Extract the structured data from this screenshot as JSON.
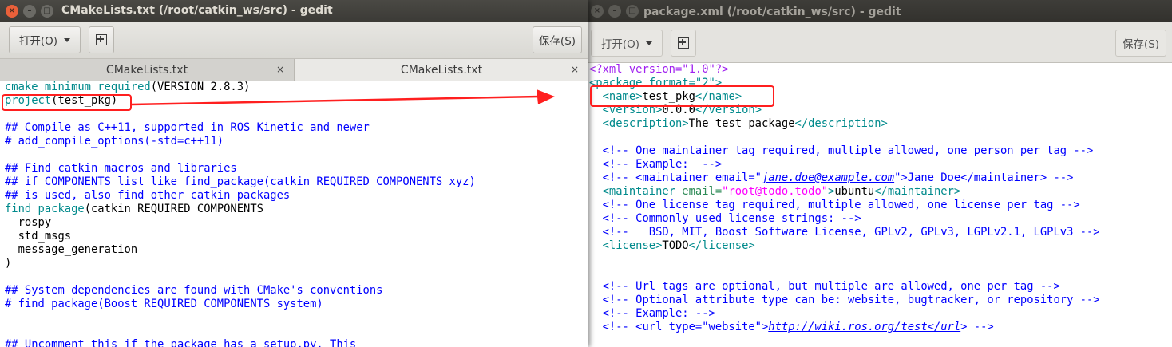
{
  "left_window": {
    "title": "CMakeLists.txt (/root/catkin_ws/src) - gedit",
    "open_label": "打开(O)",
    "save_label": "保存(S)",
    "tabs": [
      {
        "label": "CMakeLists.txt"
      },
      {
        "label": "CMakeLists.txt"
      }
    ],
    "lines": [
      {
        "parts": [
          {
            "t": "cmake_minimum_required",
            "c": "cmd"
          },
          {
            "t": "(VERSION 2.8.3)",
            "c": "txt"
          }
        ]
      },
      {
        "parts": [
          {
            "t": "project",
            "c": "cmd"
          },
          {
            "t": "(test_pkg)",
            "c": "txt"
          }
        ]
      },
      {
        "parts": []
      },
      {
        "parts": [
          {
            "t": "## Compile as C++11, supported in ROS Kinetic and newer",
            "c": "com"
          }
        ]
      },
      {
        "parts": [
          {
            "t": "# add_compile_options(-std=c++11)",
            "c": "com"
          }
        ]
      },
      {
        "parts": []
      },
      {
        "parts": [
          {
            "t": "## Find catkin macros and libraries",
            "c": "com"
          }
        ]
      },
      {
        "parts": [
          {
            "t": "## if COMPONENTS list like find_package(catkin REQUIRED COMPONENTS xyz)",
            "c": "com"
          }
        ]
      },
      {
        "parts": [
          {
            "t": "## is used, also find other catkin packages",
            "c": "com"
          }
        ]
      },
      {
        "parts": [
          {
            "t": "find_package",
            "c": "cmd"
          },
          {
            "t": "(catkin REQUIRED COMPONENTS",
            "c": "txt"
          }
        ]
      },
      {
        "parts": [
          {
            "t": "  rospy",
            "c": "txt"
          }
        ]
      },
      {
        "parts": [
          {
            "t": "  std_msgs",
            "c": "txt"
          }
        ]
      },
      {
        "parts": [
          {
            "t": "  message_generation",
            "c": "txt"
          }
        ]
      },
      {
        "parts": [
          {
            "t": ")",
            "c": "txt"
          }
        ]
      },
      {
        "parts": []
      },
      {
        "parts": [
          {
            "t": "## System dependencies are found with CMake's conventions",
            "c": "com"
          }
        ]
      },
      {
        "parts": [
          {
            "t": "# find_package(Boost REQUIRED COMPONENTS system)",
            "c": "com"
          }
        ]
      },
      {
        "parts": []
      },
      {
        "parts": []
      },
      {
        "parts": [
          {
            "t": "## Uncomment this if the package has a setup.py. This",
            "c": "com"
          }
        ]
      }
    ]
  },
  "right_window": {
    "title": "package.xml (/root/catkin_ws/src) - gedit",
    "open_label": "打开(O)",
    "save_label": "保存(S)",
    "lines": [
      {
        "parts": [
          {
            "t": "<?xml version=\"1.0\"?>",
            "c": "xmldecl"
          }
        ]
      },
      {
        "parts": [
          {
            "t": "<package format=\"2\">",
            "c": "tag"
          }
        ]
      },
      {
        "parts": [
          {
            "t": "  ",
            "c": "txt"
          },
          {
            "t": "<name>",
            "c": "tag"
          },
          {
            "t": "test_pkg",
            "c": "txt"
          },
          {
            "t": "</name>",
            "c": "tag"
          }
        ]
      },
      {
        "parts": [
          {
            "t": "  ",
            "c": "txt"
          },
          {
            "t": "<version>",
            "c": "tag"
          },
          {
            "t": "0.0.0",
            "c": "txt"
          },
          {
            "t": "</version>",
            "c": "tag"
          }
        ]
      },
      {
        "parts": [
          {
            "t": "  ",
            "c": "txt"
          },
          {
            "t": "<description>",
            "c": "tag"
          },
          {
            "t": "The test package",
            "c": "txt"
          },
          {
            "t": "</description>",
            "c": "tag"
          }
        ]
      },
      {
        "parts": []
      },
      {
        "parts": [
          {
            "t": "  <!-- One maintainer tag required, multiple allowed, one person per tag -->",
            "c": "com"
          }
        ]
      },
      {
        "parts": [
          {
            "t": "  <!-- Example:  -->",
            "c": "com"
          }
        ]
      },
      {
        "parts": [
          {
            "t": "  <!-- <maintainer email=\"",
            "c": "com"
          },
          {
            "t": "jane.doe@example.com",
            "c": "link"
          },
          {
            "t": "\">Jane Doe</maintainer> -->",
            "c": "com"
          }
        ]
      },
      {
        "parts": [
          {
            "t": "  ",
            "c": "txt"
          },
          {
            "t": "<maintainer",
            "c": "tag"
          },
          {
            "t": " email=",
            "c": "attr"
          },
          {
            "t": "\"root@todo.todo\"",
            "c": "val"
          },
          {
            "t": ">",
            "c": "tag"
          },
          {
            "t": "ubuntu",
            "c": "txt"
          },
          {
            "t": "</maintainer>",
            "c": "tag"
          }
        ]
      },
      {
        "parts": [
          {
            "t": "  <!-- One license tag required, multiple allowed, one license per tag -->",
            "c": "com"
          }
        ]
      },
      {
        "parts": [
          {
            "t": "  <!-- Commonly used license strings: -->",
            "c": "com"
          }
        ]
      },
      {
        "parts": [
          {
            "t": "  <!--   BSD, MIT, Boost Software License, GPLv2, GPLv3, LGPLv2.1, LGPLv3 -->",
            "c": "com"
          }
        ]
      },
      {
        "parts": [
          {
            "t": "  ",
            "c": "txt"
          },
          {
            "t": "<license>",
            "c": "tag"
          },
          {
            "t": "TODO",
            "c": "txt"
          },
          {
            "t": "</license>",
            "c": "tag"
          }
        ]
      },
      {
        "parts": []
      },
      {
        "parts": []
      },
      {
        "parts": [
          {
            "t": "  <!-- Url tags are optional, but multiple are allowed, one per tag -->",
            "c": "com"
          }
        ]
      },
      {
        "parts": [
          {
            "t": "  <!-- Optional attribute type can be: website, bugtracker, or repository -->",
            "c": "com"
          }
        ]
      },
      {
        "parts": [
          {
            "t": "  <!-- Example: -->",
            "c": "com"
          }
        ]
      },
      {
        "parts": [
          {
            "t": "  <!-- <url type=\"website\">",
            "c": "com"
          },
          {
            "t": "http://wiki.ros.org/test</url",
            "c": "link"
          },
          {
            "t": "> -->",
            "c": "com"
          }
        ]
      }
    ]
  },
  "icons": {
    "close": "close-icon",
    "minimize": "minimize-icon",
    "maximize": "maximize-icon",
    "new_document": "new-document-icon",
    "tab_close": "tab-close-icon"
  },
  "colors": {
    "annotation_red": "#ff1f1f",
    "command": "#008a8c",
    "comment": "#0000ff",
    "xml_decl": "#a020f0",
    "attr_value": "#ff00ff"
  }
}
